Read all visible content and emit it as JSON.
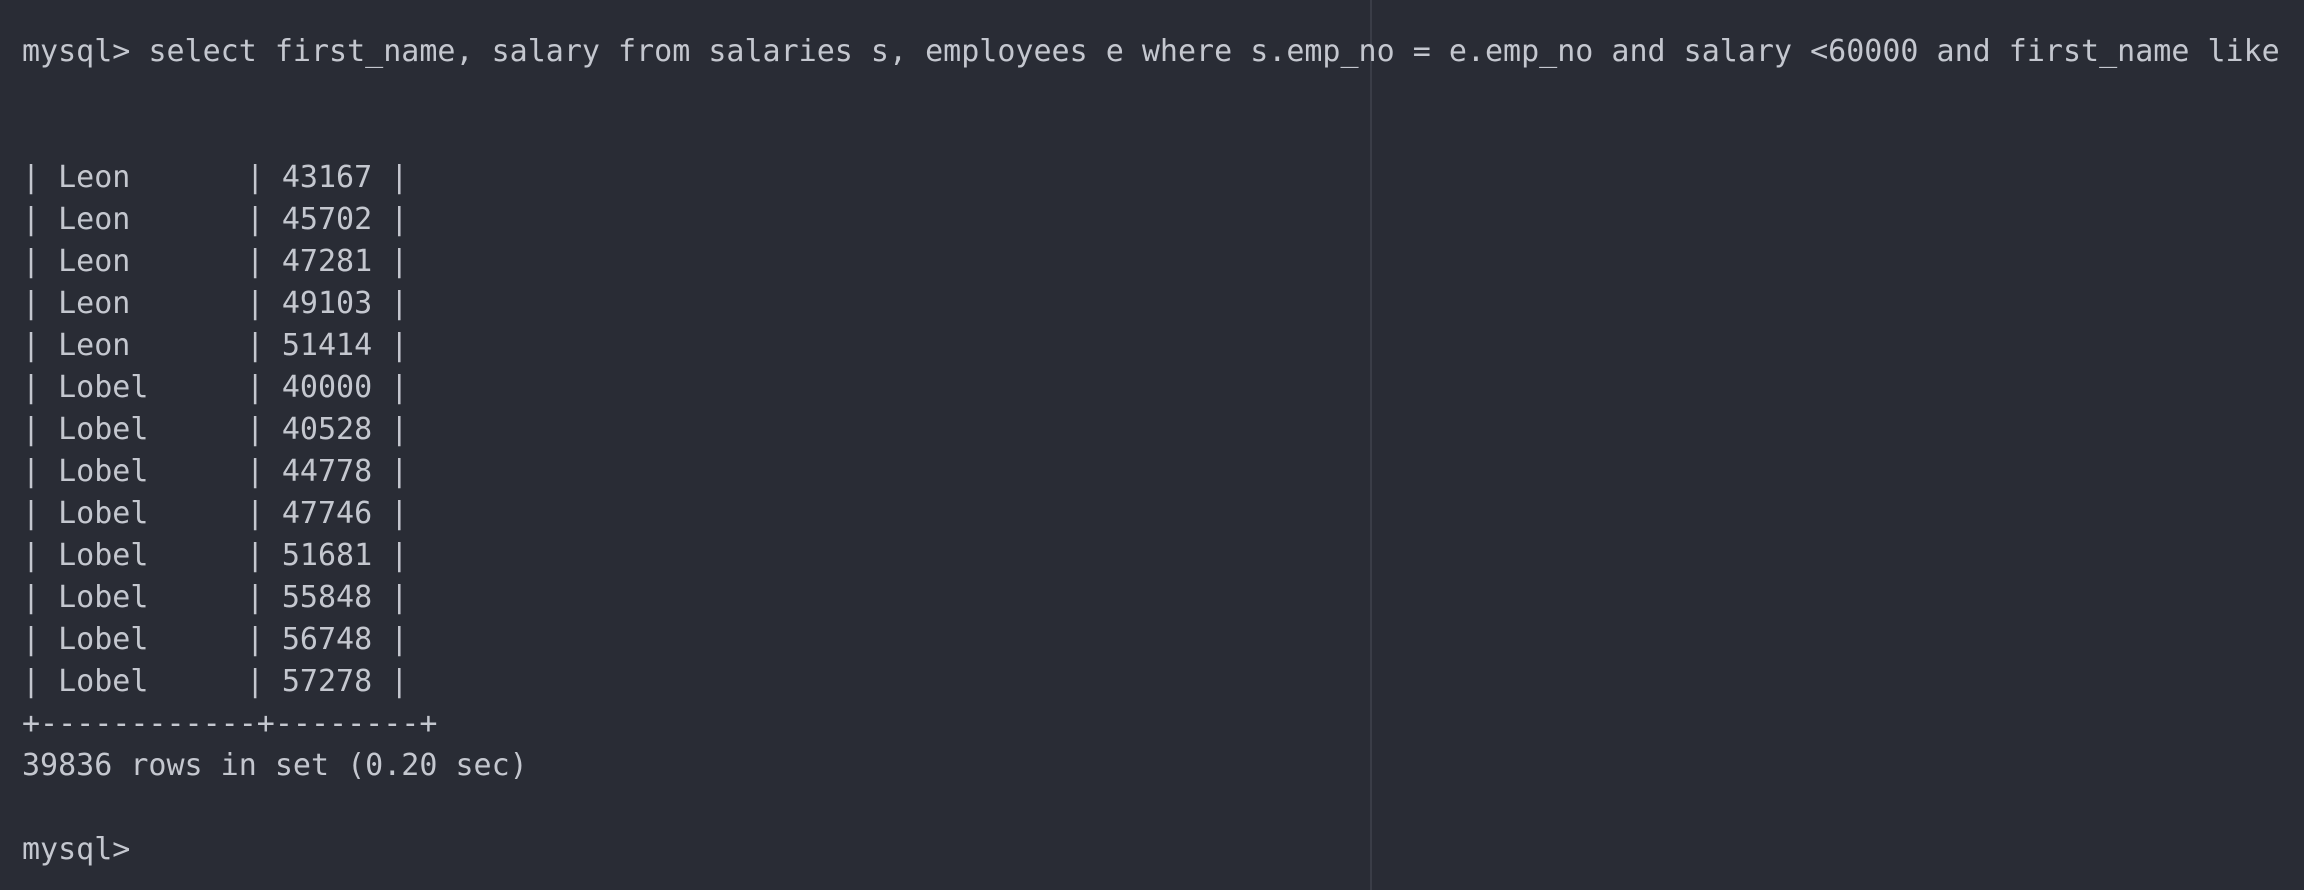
{
  "terminal": {
    "command_prompt": "mysql> ",
    "command_text": "select first_name, salary from salaries s, employees e where s.emp_no = e.emp_no and salary <60000 and first_name like 'l%';",
    "rows": [
      {
        "name": "Leon",
        "salary": "43167"
      },
      {
        "name": "Leon",
        "salary": "45702"
      },
      {
        "name": "Leon",
        "salary": "47281"
      },
      {
        "name": "Leon",
        "salary": "49103"
      },
      {
        "name": "Leon",
        "salary": "51414"
      },
      {
        "name": "Lobel",
        "salary": "40000"
      },
      {
        "name": "Lobel",
        "salary": "40528"
      },
      {
        "name": "Lobel",
        "salary": "44778"
      },
      {
        "name": "Lobel",
        "salary": "47746"
      },
      {
        "name": "Lobel",
        "salary": "51681"
      },
      {
        "name": "Lobel",
        "salary": "55848"
      },
      {
        "name": "Lobel",
        "salary": "56748"
      },
      {
        "name": "Lobel",
        "salary": "57278"
      }
    ],
    "table_border": "+------------+--------+",
    "summary": "39836 rows in set (0.20 sec)",
    "final_prompt": "mysql>"
  },
  "colors": {
    "background": "#292c35",
    "text": "#c4c7cf",
    "divider": "#3a3d47"
  }
}
